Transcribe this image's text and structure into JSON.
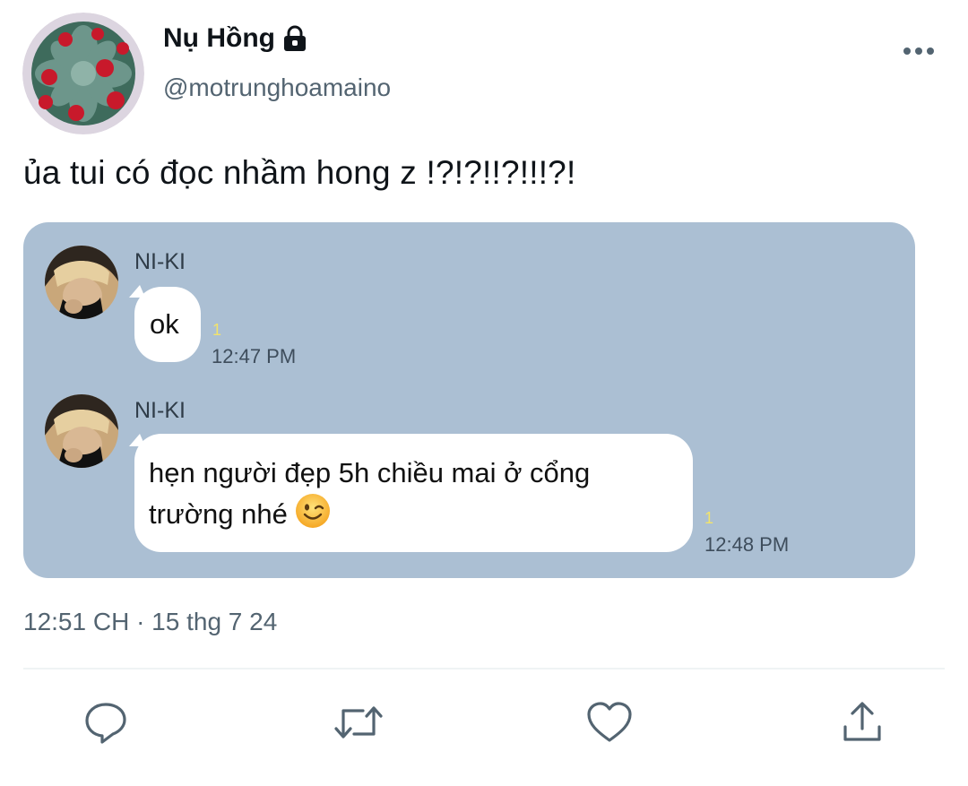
{
  "tweet": {
    "display_name": "Nụ Hồng",
    "handle": "@motrunghoamaino",
    "text": "ủa tui có đọc nhầm hong z !?!?!!?!!!?!",
    "timestamp": "12:51 CH · 15 thg 7 24",
    "icons": {
      "lock": "lock-icon",
      "more": "more-icon",
      "reply": "reply-icon",
      "retweet": "retweet-icon",
      "like": "heart-icon",
      "share": "share-icon"
    }
  },
  "chat": {
    "messages": [
      {
        "sender": "NI-KI",
        "text": "ok",
        "read": "1",
        "time": "12:47 PM"
      },
      {
        "sender": "NI-KI",
        "text_line1": "hẹn người đẹp 5h chiều mai ở cổng",
        "text_line2": "trường nhé",
        "emoji": "winking-face",
        "read": "1",
        "time": "12:48 PM"
      }
    ]
  },
  "colors": {
    "media_bg": "#abbfd3",
    "secondary_text": "#536471",
    "read_receipt": "#f2e36b"
  }
}
